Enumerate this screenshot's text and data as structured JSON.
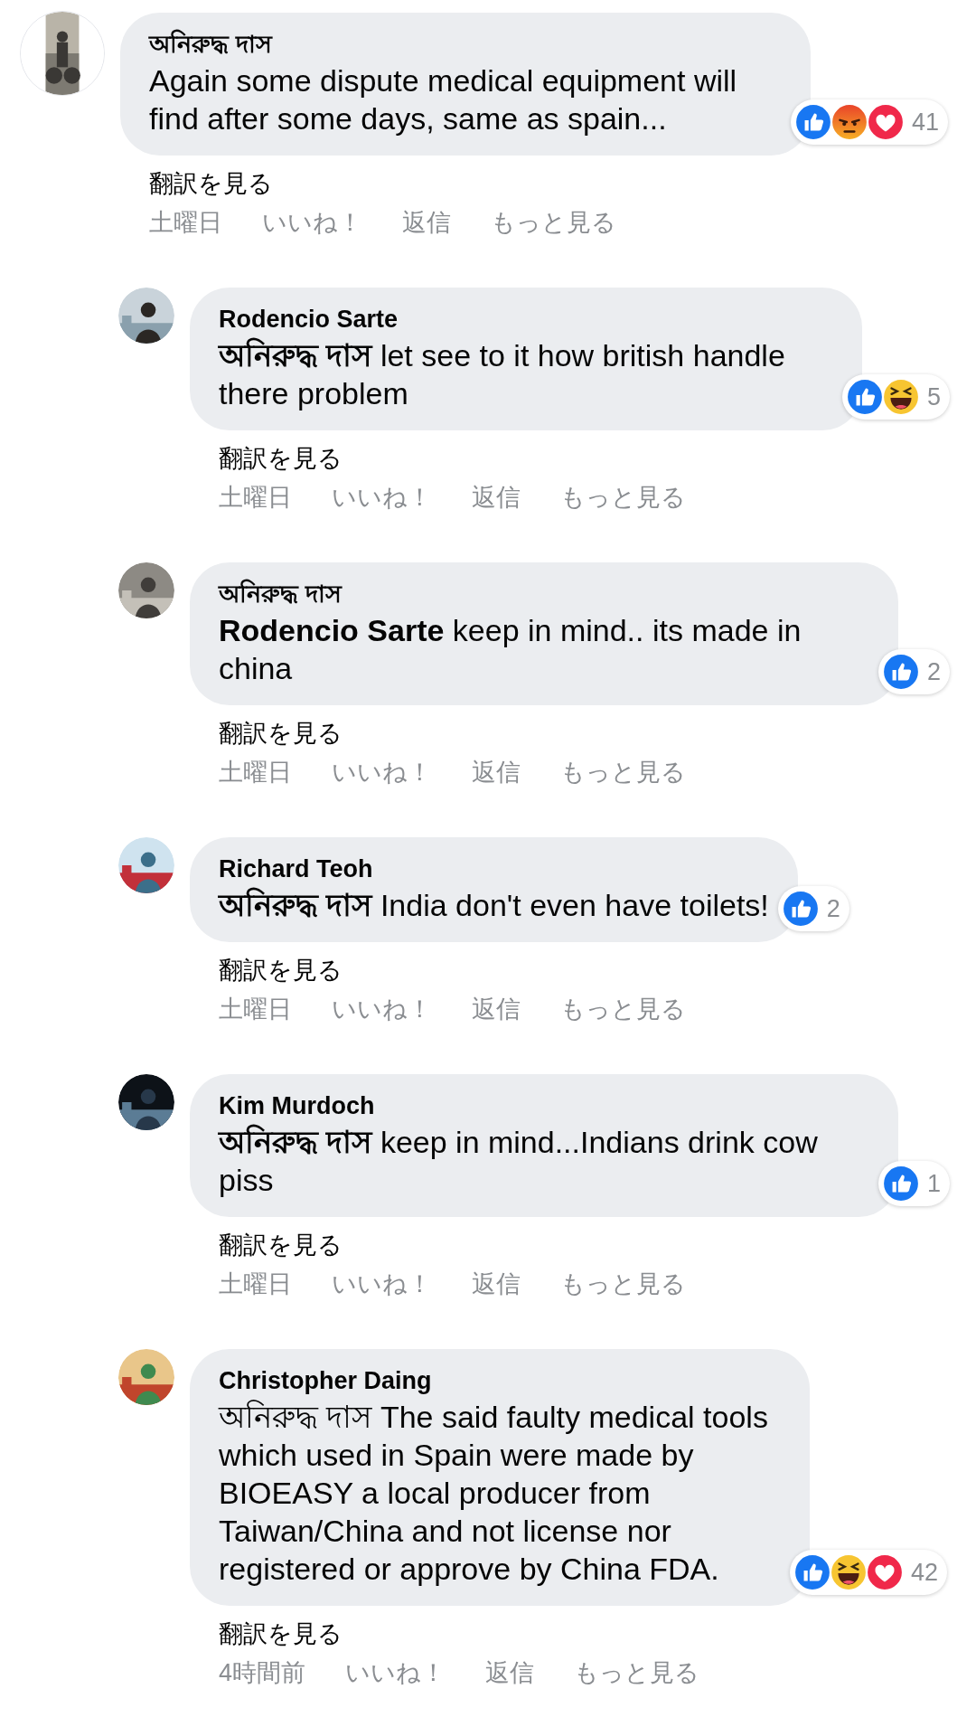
{
  "comments": [
    {
      "author": "অনিরুদ্ধ দাস",
      "text": "Again some dispute medical equipment will find after some days, same as spain...",
      "reactions": [
        {
          "kind": "like"
        },
        {
          "kind": "angry"
        },
        {
          "kind": "love"
        }
      ],
      "reaction_count": "41",
      "translate": "翻訳を見る",
      "time": "土曜日",
      "like": "いいね！",
      "reply": "返信",
      "more": "もっと見る",
      "replies": [
        {
          "author": "Rodencio Sarte",
          "text": "**অনিরুদ্ধ দাস** let see to it how british handle there problem",
          "reactions": [
            {
              "kind": "like"
            },
            {
              "kind": "haha"
            }
          ],
          "reaction_count": "5",
          "translate": "翻訳を見る",
          "time": "土曜日",
          "like": "いいね！",
          "reply": "返信",
          "more": "もっと見る"
        },
        {
          "author": "অনিরুদ্ধ দাস",
          "text": "**Rodencio Sarte** keep in mind.. its made in china",
          "reactions": [
            {
              "kind": "like"
            }
          ],
          "reaction_count": "2",
          "translate": "翻訳を見る",
          "time": "土曜日",
          "like": "いいね！",
          "reply": "返信",
          "more": "もっと見る"
        },
        {
          "author": "Richard Teoh",
          "text": "**অনিরুদ্ধ দাস** India don't even have toilets!",
          "reactions": [
            {
              "kind": "like"
            }
          ],
          "reaction_count": "2",
          "translate": "翻訳を見る",
          "time": "土曜日",
          "like": "いいね！",
          "reply": "返信",
          "more": "もっと見る"
        },
        {
          "author": "Kim Murdoch",
          "text": "**অনিরুদ্ধ দাস** keep in mind...Indians drink cow piss",
          "reactions": [
            {
              "kind": "like"
            }
          ],
          "reaction_count": "1",
          "translate": "翻訳を見る",
          "time": "土曜日",
          "like": "いいね！",
          "reply": "返信",
          "more": "もっと見る"
        },
        {
          "author": "Christopher Daing",
          "text": "অনিরুদ্ধ দাস The said faulty medical tools which used in Spain were made by BIOEASY a local producer from Taiwan/China and not license nor registered or approve by China FDA.",
          "reactions": [
            {
              "kind": "like"
            },
            {
              "kind": "haha"
            },
            {
              "kind": "love"
            }
          ],
          "reaction_count": "42",
          "translate": "翻訳を見る",
          "time": "4時間前",
          "like": "いいね！",
          "reply": "返信",
          "more": "もっと見る"
        }
      ]
    }
  ]
}
